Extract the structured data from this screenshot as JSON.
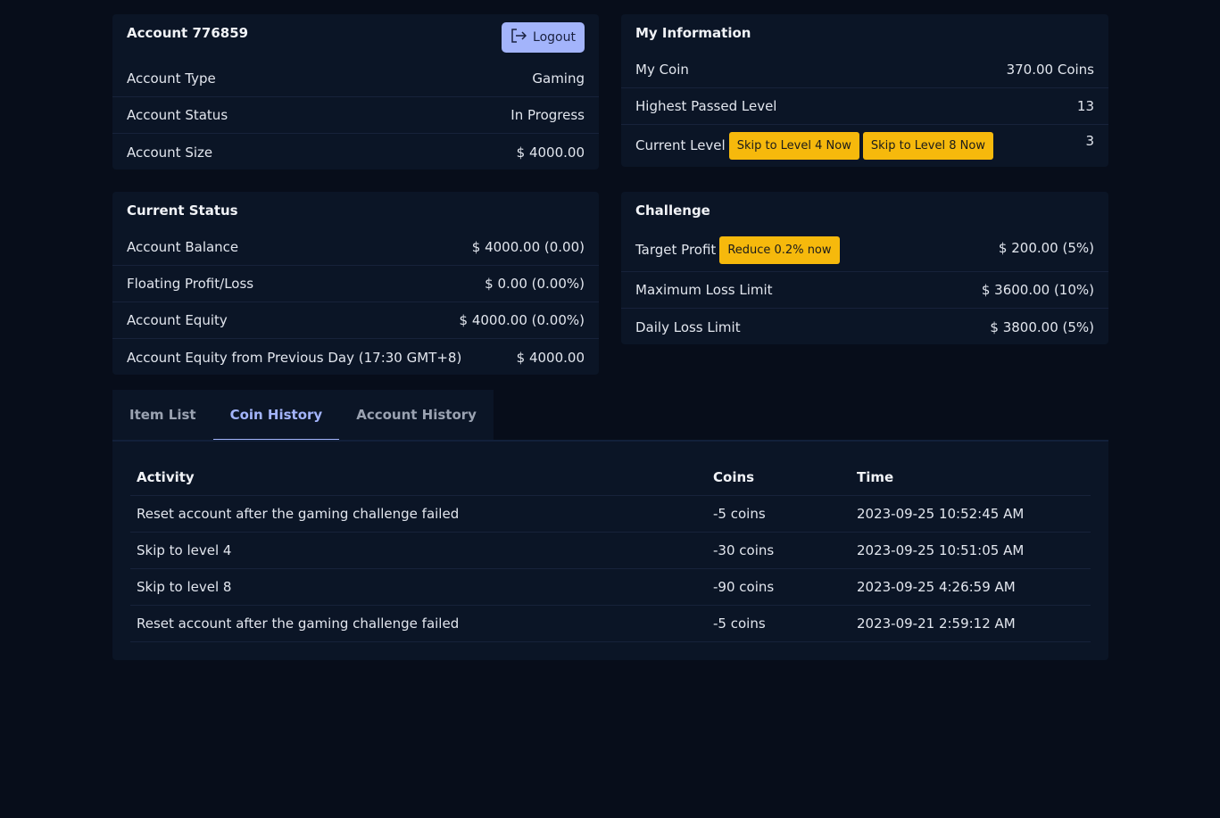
{
  "account": {
    "title": "Account 776859",
    "logout_label": "Logout",
    "rows": [
      {
        "label": "Account Type",
        "value": "Gaming"
      },
      {
        "label": "Account Status",
        "value": "In Progress"
      },
      {
        "label": "Account Size",
        "value": "$ 4000.00"
      }
    ]
  },
  "my_info": {
    "title": "My Information",
    "rows": [
      {
        "label": "My Coin",
        "value": "370.00 Coins"
      },
      {
        "label": "Highest Passed Level",
        "value": "13"
      },
      {
        "label": "Current Level",
        "value": "3"
      }
    ],
    "skip4_label": "Skip to Level 4 Now",
    "skip8_label": "Skip to Level 8 Now"
  },
  "current_status": {
    "title": "Current Status",
    "rows": [
      {
        "label": "Account Balance",
        "value": "$ 4000.00 (0.00)"
      },
      {
        "label": "Floating Profit/Loss",
        "value": "$ 0.00 (0.00%)"
      },
      {
        "label": "Account Equity",
        "value": "$ 4000.00 (0.00%)"
      },
      {
        "label": "Account Equity from Previous Day (17:30 GMT+8)",
        "value": "$ 4000.00"
      }
    ]
  },
  "challenge": {
    "title": "Challenge",
    "rows": [
      {
        "label": "Target Profit",
        "value": "$ 200.00 (5%)"
      },
      {
        "label": "Maximum Loss Limit",
        "value": "$ 3600.00 (10%)"
      },
      {
        "label": "Daily Loss Limit",
        "value": "$ 3800.00 (5%)"
      }
    ],
    "reduce_label": "Reduce 0.2% now"
  },
  "tabs": [
    {
      "label": "Item List"
    },
    {
      "label": "Coin History"
    },
    {
      "label": "Account History"
    }
  ],
  "table": {
    "headers": [
      "Activity",
      "Coins",
      "Time"
    ],
    "rows": [
      [
        "Reset account after the gaming challenge failed",
        "-5 coins",
        "2023-09-25 10:52:45 AM"
      ],
      [
        "Skip to level 4",
        "-30 coins",
        "2023-09-25 10:51:05 AM"
      ],
      [
        "Skip to level 8",
        "-90 coins",
        "2023-09-25 4:26:59 AM"
      ],
      [
        "Reset account after the gaming challenge failed",
        "-5 coins",
        "2023-09-21 2:59:12 AM"
      ]
    ]
  },
  "icons": {
    "logout": "logout-icon"
  },
  "colors": {
    "accent": "#a3b4fb",
    "warning": "#f6b90c",
    "background": "#070d1a",
    "card": "#0b1526"
  }
}
